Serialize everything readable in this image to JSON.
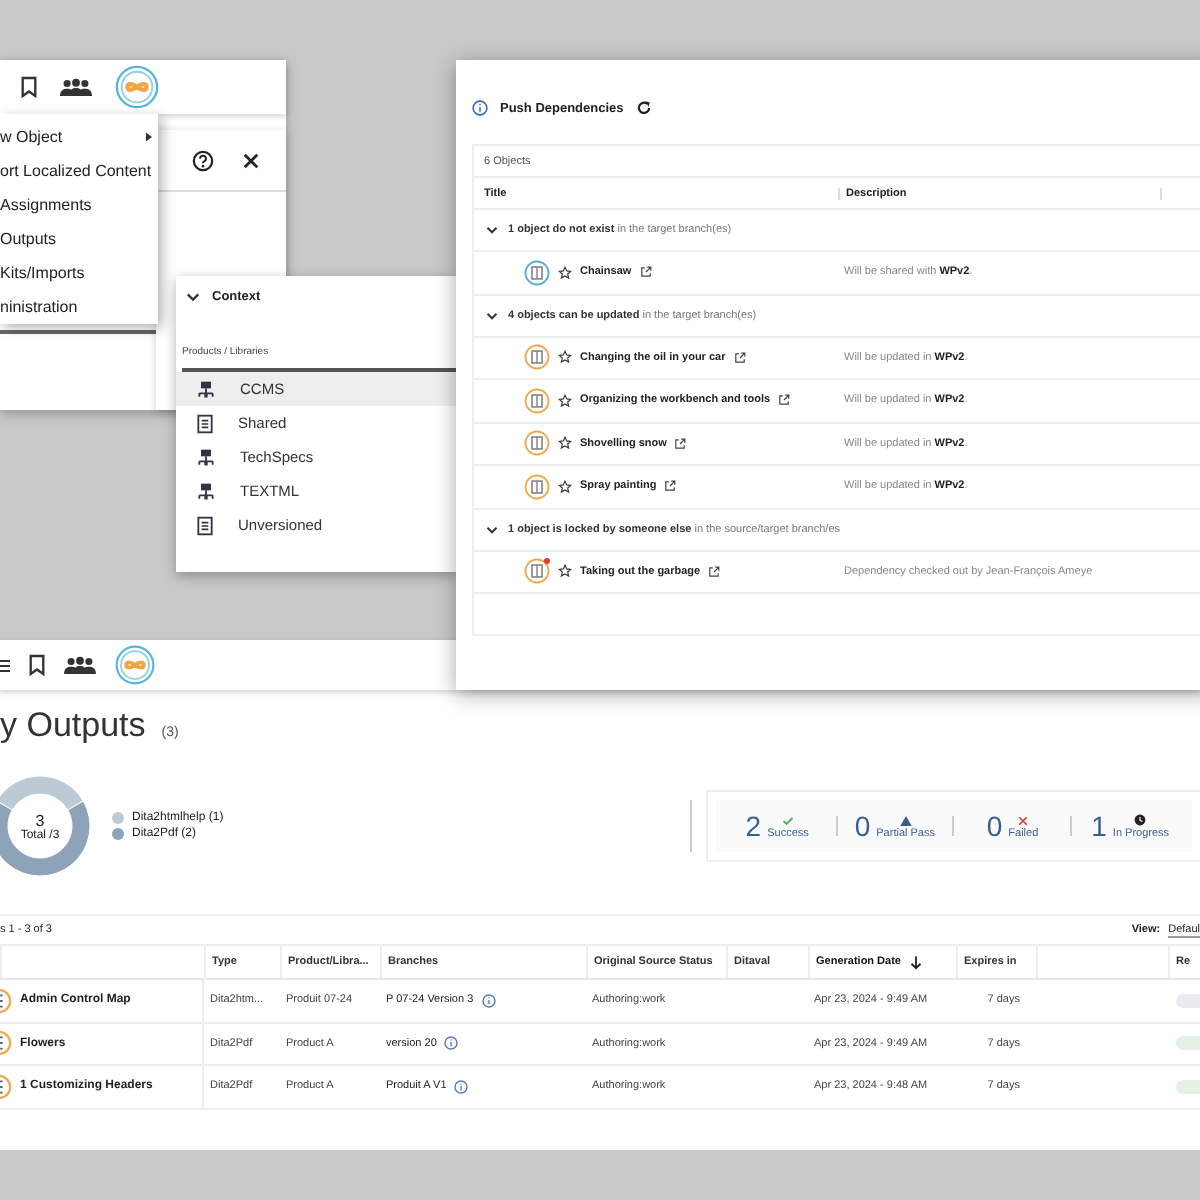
{
  "menu_window": {
    "menu": [
      {
        "label": "w Object",
        "submenu": true
      },
      {
        "label": "ort Localized Content",
        "submenu": false
      },
      {
        "label": "Assignments",
        "submenu": false
      },
      {
        "label": "Outputs",
        "submenu": false
      },
      {
        "label": "Kits/Imports",
        "submenu": false
      },
      {
        "label": "ninistration",
        "submenu": false
      }
    ]
  },
  "context": {
    "title": "Context",
    "expanded": true,
    "field_label": "Products / Libraries",
    "items": [
      {
        "label": "CCMS",
        "kind": "library",
        "selected": true
      },
      {
        "label": "Shared",
        "kind": "folder",
        "selected": false
      },
      {
        "label": "TechSpecs",
        "kind": "library",
        "selected": false
      },
      {
        "label": "TEXTML",
        "kind": "library",
        "selected": false
      },
      {
        "label": "Unversioned",
        "kind": "folder",
        "selected": false
      }
    ]
  },
  "push": {
    "title": "Push Dependencies",
    "count": "6 Objects",
    "columns": [
      "Title",
      "Description"
    ],
    "groups": [
      {
        "summary": "**1 object do not exist** in the target branch(es)",
        "expanded": true,
        "rows": [
          {
            "title": "Chainsaw",
            "description": "Will be shared with **WPv2**.",
            "color": "#5aaad8",
            "locked": false
          }
        ]
      },
      {
        "summary": "**4 objects can be updated** in the target branch(es)",
        "expanded": true,
        "rows": [
          {
            "title": "Changing the oil in your car",
            "description": "Will be updated in **WPv2**.",
            "color": "#f0a848",
            "locked": false
          },
          {
            "title": "Organizing the workbench and tools",
            "description": "Will be updated in **WPv2**.",
            "color": "#f0a848",
            "locked": false
          },
          {
            "title": "Shovelling snow",
            "description": "Will be updated in **WPv2**.",
            "color": "#f0a848",
            "locked": false
          },
          {
            "title": "Spray painting",
            "description": "Will be updated in **WPv2**.",
            "color": "#f0a848",
            "locked": false
          }
        ]
      },
      {
        "summary": "**1 object is locked by someone else** in the source/target branch/es",
        "expanded": true,
        "rows": [
          {
            "title": "Taking out the garbage",
            "description": "Dependency checked out by Jean-François Ameye",
            "color": "#f0a848",
            "locked": true
          }
        ]
      }
    ]
  },
  "outputs": {
    "title": "y Outputs",
    "count": "(3)",
    "donut": {
      "total": "3",
      "total_label": "Total /3",
      "chart_data": {
        "type": "donut",
        "categories": [
          "Dita2htmlhelp",
          "Dita2Pdf"
        ],
        "values": [
          1,
          2
        ]
      }
    },
    "legend": [
      {
        "count": "(1)",
        "color": "#bccad6"
      },
      {
        "count": "(2)",
        "color": "#8ea3b7"
      }
    ],
    "statuses": [
      {
        "count": "2",
        "label": "Success",
        "kind": "success"
      },
      {
        "count": "0",
        "label": "Partial Pass",
        "kind": "partial"
      },
      {
        "count": "0",
        "label": "Failed",
        "kind": "failed"
      },
      {
        "count": "1",
        "label": "In Progress",
        "kind": "progress"
      }
    ],
    "range": "s 1 - 3 of 3",
    "view_label": "View:",
    "view_value": "Defaul",
    "columns": [
      {
        "sorted": false
      },
      {
        "label": "Type",
        "sorted": false
      },
      {
        "label": "Product/Libra...",
        "sorted": false
      },
      {
        "label": "Branches",
        "sorted": false
      },
      {
        "label": "Original Source Status",
        "sorted": false
      },
      {
        "label": "Ditaval",
        "sorted": false
      },
      {
        "label": "Generation Date",
        "sorted": true
      },
      {
        "label": "Expires in",
        "sorted": false
      },
      {
        "sorted": false
      },
      {
        "label": "Re",
        "sorted": false
      }
    ],
    "rows": [
      {
        "title": "Admin Control Map",
        "type": "Dita2htm...",
        "product": "Produit 07-24",
        "branch": "P 07-24 Version 3",
        "status": "Authoring:work",
        "date": "Apr 23, 2024 - 9:49 AM",
        "expires": "7 days",
        "color": "#e8ebef"
      },
      {
        "title": "Flowers",
        "type": "Dita2Pdf",
        "product": "Product A",
        "branch": "version 20",
        "status": "Authoring:work",
        "date": "Apr 23, 2024 - 9:49 AM",
        "expires": "7 days",
        "color": "#e6f1e6"
      },
      {
        "title": "1 Customizing Headers",
        "type": "Dita2Pdf",
        "product": "Product A",
        "branch": "Produit A V1",
        "status": "Authoring:work",
        "date": "Apr 23, 2024 - 9:48 AM",
        "expires": "7 days",
        "color": "#e6f1e6"
      }
    ]
  }
}
